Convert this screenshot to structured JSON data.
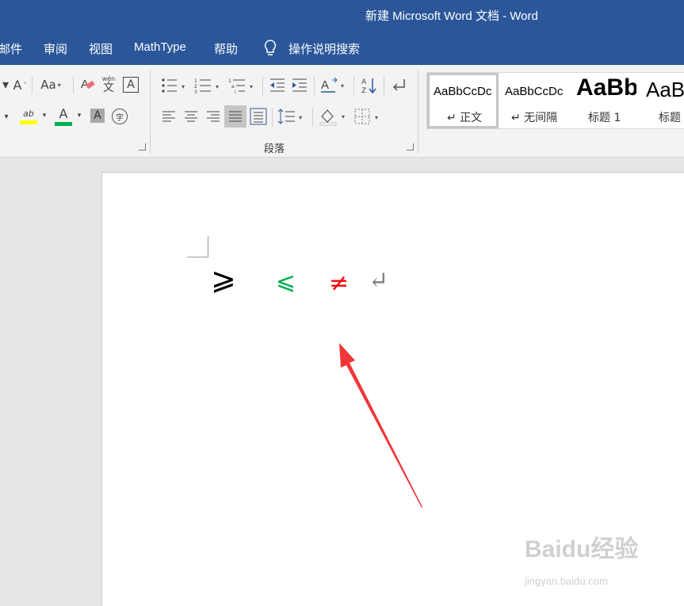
{
  "window": {
    "title": "新建 Microsoft Word 文档  -  Word"
  },
  "menu": {
    "items": [
      "邮件",
      "审阅",
      "视图",
      "MathType",
      "帮助"
    ],
    "tell_me": "操作说明搜索"
  },
  "ribbon": {
    "font_group": {
      "case_button": "Aa",
      "shrink_font": "A",
      "phonetic_top": "wén",
      "phonetic_bottom": "文",
      "char_border": "A",
      "highlight": "ab",
      "font_color": "A",
      "char_shading": "A",
      "enclose": "字"
    },
    "paragraph_group": {
      "label": "段落"
    },
    "styles": [
      {
        "sample": "AaBbCcDc",
        "name": "↵ 正文"
      },
      {
        "sample": "AaBbCcDc",
        "name": "↵ 无间隔"
      },
      {
        "sample": "AaBb",
        "name": "标题 1"
      },
      {
        "sample": "AaB",
        "name": "标题"
      }
    ]
  },
  "document": {
    "symbols": [
      {
        "text": "⩾",
        "color": "#000000"
      },
      {
        "text": "⩽",
        "color": "#00b050"
      },
      {
        "text": "≠",
        "color": "#ff0000"
      },
      {
        "text": "↵",
        "color": "#7f7f7f"
      }
    ]
  },
  "watermark": {
    "brand": "Baidu经验",
    "url": "jingyan.baidu.com"
  },
  "colors": {
    "accent": "#2b579a",
    "highlight_yellow": "#ffff00",
    "font_color_green": "#00b050",
    "arrow_red": "#f0363a"
  }
}
